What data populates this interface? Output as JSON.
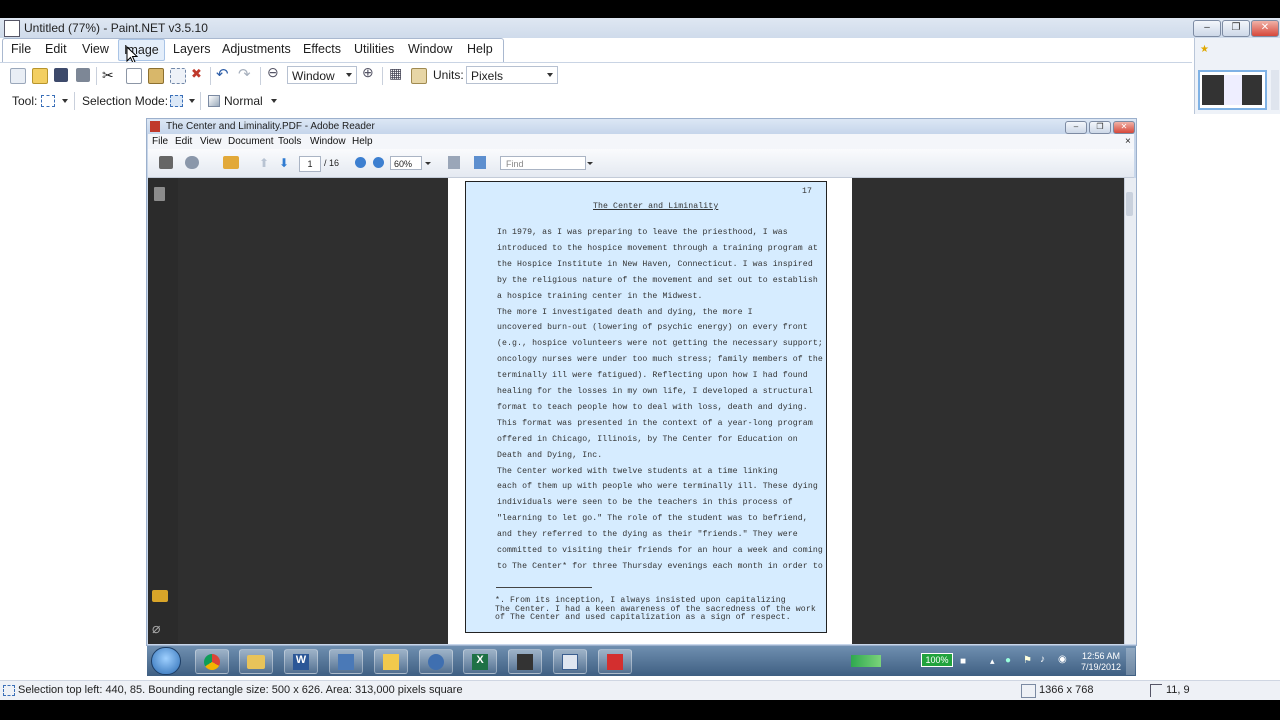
{
  "paintnet": {
    "window_title": "Untitled (77%) - Paint.NET v3.5.10",
    "menu": [
      "File",
      "Edit",
      "View",
      "Image",
      "Layers",
      "Adjustments",
      "Effects",
      "Utilities",
      "Window",
      "Help"
    ],
    "toolbar": {
      "zoom_combo": "Window",
      "units_label": "Units:",
      "units_value": "Pixels",
      "tool_label": "Tool:",
      "selection_mode_label": "Selection Mode:",
      "blend_mode": "Normal"
    },
    "status": {
      "selection": "Selection top left: 440, 85. Bounding rectangle size: 500 x 626. Area: 313,000 pixels square",
      "image_size": "1366 x 768",
      "cursor": "11, 9"
    }
  },
  "reader": {
    "window_title": "The Center and Liminality.PDF - Adobe Reader",
    "menu": [
      "File",
      "Edit",
      "View",
      "Document",
      "Tools",
      "Window",
      "Help"
    ],
    "page_current": "1",
    "page_total": "/ 16",
    "zoom": "60%",
    "find_placeholder": "Find"
  },
  "document": {
    "page_number": "17",
    "title": "The Center and Liminality",
    "lines": [
      "    In 1979, as I was preparing to leave the priesthood, I was",
      "introduced to the hospice movement through a training program at",
      "the Hospice Institute in New Haven, Connecticut.  I was inspired",
      "by the religious nature of the movement and set out to establish",
      "a hospice training center in the Midwest.",
      "    The more I investigated death and dying, the more I",
      "uncovered burn-out (lowering of psychic energy) on every front",
      "(e.g., hospice volunteers were not getting the necessary support;",
      "oncology nurses were under too much stress; family members of the",
      "terminally ill were fatigued).  Reflecting upon how I had found",
      "healing for the losses in my own life, I developed a structural",
      "format to teach people how to deal with loss, death and dying.",
      "This format was presented in the context of a year-long program",
      "offered in Chicago, Illinois, by The Center for Education on",
      "Death and Dying, Inc.",
      "    The Center worked with twelve students at a time linking",
      "each of them up with people who were terminally ill.  These dying",
      "individuals were seen to be the teachers in this process of",
      "\"learning to let go.\"  The role of the student was to befriend,",
      "and they referred to the dying as their \"friends.\"  They were",
      "committed to visiting their friends for an hour a week and coming",
      "to The Center* for three Thursday evenings each month in order to"
    ],
    "footnote": [
      "    *.  From its inception, I always insisted upon capitalizing",
      "The Center.  I had a keen awareness of the sacredness of the work",
      "of The Center and used capitalization as a sign of respect."
    ]
  },
  "taskbar": {
    "battery": "100%",
    "time": "12:56 AM",
    "date": "7/19/2012"
  },
  "colors": {
    "selection_fill": "#d6ecff",
    "reader_frame": "#c7d6ea",
    "taskbar": "#4f6f93"
  }
}
